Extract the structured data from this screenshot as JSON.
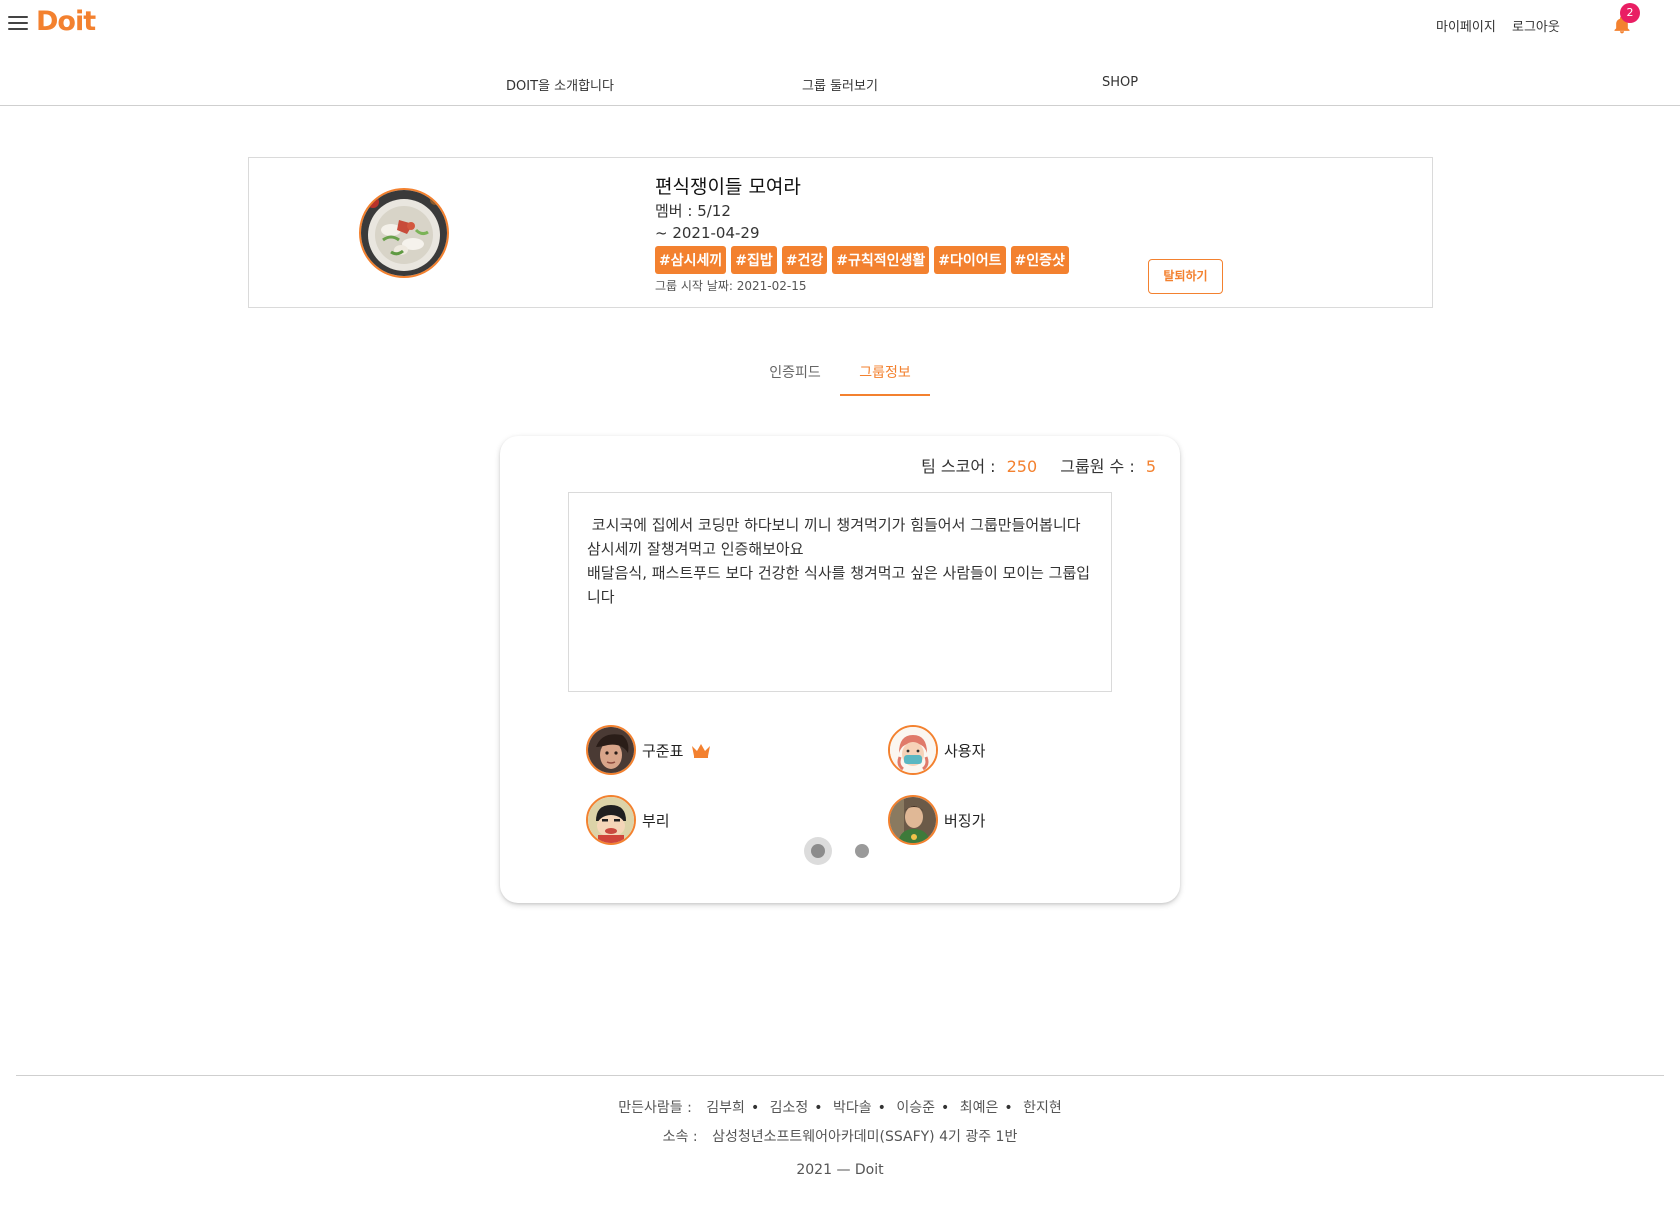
{
  "header": {
    "logo": "Doit",
    "links": [
      "마이페이지",
      "로그아웃"
    ],
    "notification_count": "2",
    "accent": "#f3812f",
    "badge_color": "#e91e63"
  },
  "nav": {
    "items": [
      "DOIT을 소개합니다",
      "그룹 둘러보기",
      "SHOP"
    ]
  },
  "group": {
    "title": "편식쟁이들 모여라",
    "members": "멤버 : 5/12",
    "end_date": "~ 2021-04-29",
    "tags": [
      "#삼시세끼",
      "#집밥",
      "#건강",
      "#규칙적인생활",
      "#다이어트",
      "#인증샷"
    ],
    "start_date": "그룹 시작 날짜: 2021-02-15",
    "leave_button": "탈퇴하기"
  },
  "tabs": [
    {
      "label": "인증피드",
      "active": false
    },
    {
      "label": "그룹정보",
      "active": true
    }
  ],
  "info": {
    "team_score_label": "팀 스코어 :",
    "team_score_value": "250",
    "member_count_label": "그룹원 수 :",
    "member_count_value": "5",
    "description": " 코시국에 집에서 코딩만 하다보니 끼니 챙겨먹기가 힘들어서 그룹만들어봅니다\n삼시세끼 잘챙겨먹고 인증해보아요\n배달음식, 패스트푸드 보다 건강한 식사를 챙겨먹고 싶은 사람들이 모이는 그룹입니다",
    "members": [
      {
        "name": "구준표",
        "leader": true
      },
      {
        "name": "사용자",
        "leader": false
      },
      {
        "name": "부리",
        "leader": false
      },
      {
        "name": "버징가",
        "leader": false
      }
    ],
    "pages": 2,
    "current_page": 1
  },
  "footer": {
    "makers_label": "만든사람들 :",
    "makers": [
      "김부희",
      "김소정",
      "박다솔",
      "이승준",
      "최예은",
      "한지현"
    ],
    "affiliation_label": "소속 :",
    "affiliation": "삼성청년소프트웨어아카데미(SSAFY) 4기 광주 1반",
    "copyright": "2021 — Doit"
  }
}
